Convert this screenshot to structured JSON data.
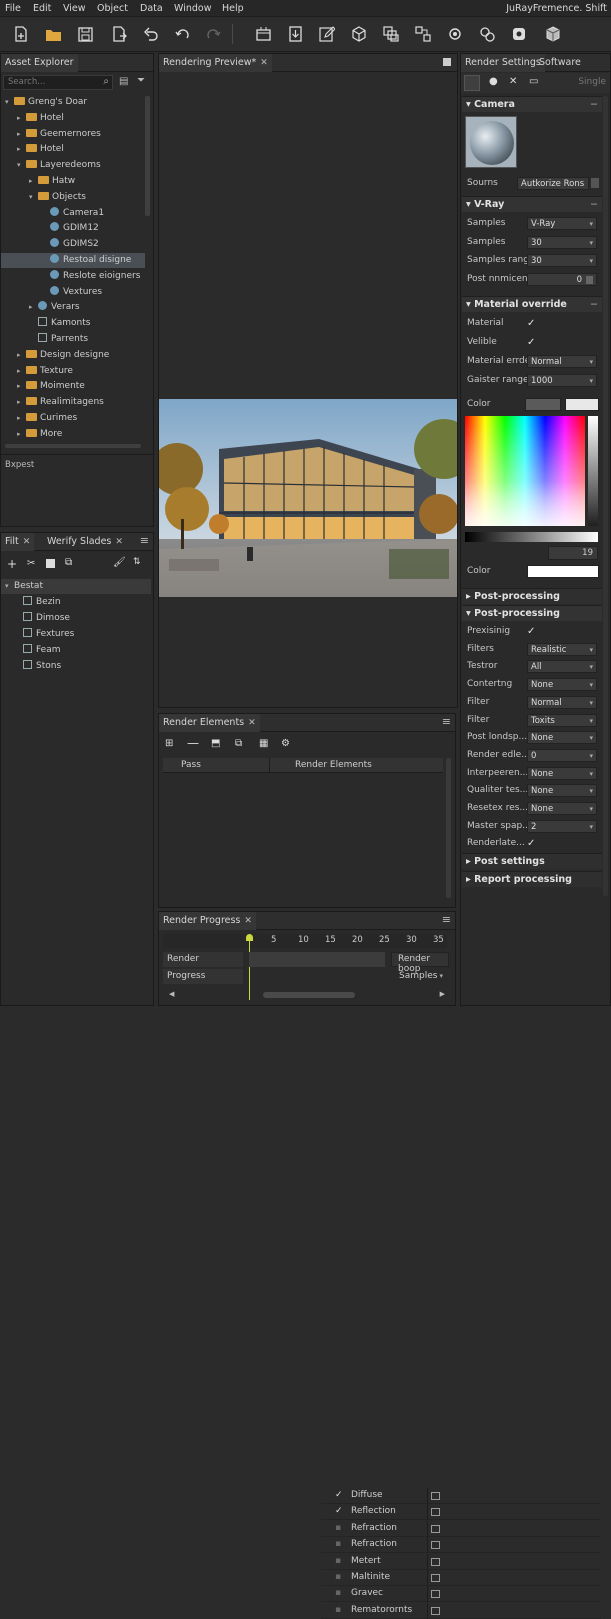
{
  "menu": {
    "items": [
      "File",
      "Edit",
      "View",
      "Object",
      "Data",
      "Window",
      "Help"
    ],
    "title": "JuRayFremence. Shift"
  },
  "toolbar": {
    "icons": [
      "new-file-icon",
      "open-folder-icon",
      "save-icon",
      "export-icon",
      "undo-icon",
      "undo-alt-icon",
      "redo-icon",
      "render-region-icon",
      "import-icon",
      "edit-icon",
      "cube-icon",
      "layers-icon",
      "transform-icon",
      "settings-icon",
      "gears-icon",
      "package-icon"
    ]
  },
  "asset_explorer": {
    "tab": "Asset Explorer",
    "search_placeholder": "Search...",
    "tree": [
      {
        "label": "Greng's Doar",
        "level": 0,
        "type": "folder",
        "open": true
      },
      {
        "label": "Hotel",
        "level": 1,
        "type": "folder"
      },
      {
        "label": "Geemernores",
        "level": 1,
        "type": "folder"
      },
      {
        "label": "Hotel",
        "level": 1,
        "type": "folder"
      },
      {
        "label": "Layeredeoms",
        "level": 1,
        "type": "folder",
        "open": true
      },
      {
        "label": "Hatw",
        "level": 2,
        "type": "folder"
      },
      {
        "label": "Objects",
        "level": 2,
        "type": "folder",
        "open": true
      },
      {
        "label": "Camera1",
        "level": 3,
        "type": "geo"
      },
      {
        "label": "GDIM12",
        "level": 3,
        "type": "geo"
      },
      {
        "label": "GDIMS2",
        "level": 3,
        "type": "geo"
      },
      {
        "label": "Restoal disigne",
        "level": 3,
        "type": "geo",
        "selected": true
      },
      {
        "label": "Reslote eioigners",
        "level": 3,
        "type": "geo"
      },
      {
        "label": "Vextures",
        "level": 3,
        "type": "geo"
      },
      {
        "label": "Verars",
        "level": 2,
        "type": "geo"
      },
      {
        "label": "Kamonts",
        "level": 2,
        "type": "square"
      },
      {
        "label": "Parrents",
        "level": 2,
        "type": "square"
      },
      {
        "label": "Design designe",
        "level": 1,
        "type": "folder"
      },
      {
        "label": "Texture",
        "level": 1,
        "type": "folder"
      },
      {
        "label": "Moimente",
        "level": 1,
        "type": "folder"
      },
      {
        "label": "Realimitagens",
        "level": 1,
        "type": "folder"
      },
      {
        "label": "Curimes",
        "level": 1,
        "type": "folder"
      },
      {
        "label": "More",
        "level": 1,
        "type": "folder"
      }
    ],
    "footer": "Bxpest"
  },
  "filter_panel": {
    "tabs": [
      "Filt",
      "Werify Slades"
    ],
    "items": [
      {
        "label": "Bestat",
        "header": true
      },
      {
        "label": "Bezin"
      },
      {
        "label": "Dimose"
      },
      {
        "label": "Fextures"
      },
      {
        "label": "Feam"
      },
      {
        "label": "Stons"
      }
    ]
  },
  "preview": {
    "tab": "Rendering Preview*"
  },
  "render_elements": {
    "tab": "Render Elements",
    "col_pass": "Pass",
    "col_elements": "Render Elements",
    "rows": [
      {
        "name": "Diffuse",
        "checked": true
      },
      {
        "name": "Reflection",
        "checked": true
      },
      {
        "name": "Refraction",
        "checked": false
      },
      {
        "name": "Refraction",
        "checked": false
      },
      {
        "name": "Metert",
        "checked": false
      },
      {
        "name": "Maltinite",
        "checked": false
      },
      {
        "name": "Gravec",
        "checked": false
      },
      {
        "name": "Rematorornts",
        "checked": false
      }
    ]
  },
  "render_progress": {
    "tab": "Render Progress",
    "ticks": [
      "5",
      "10",
      "15",
      "20",
      "25",
      "30",
      "35"
    ],
    "render_label": "Render",
    "progress_label": "Progress",
    "render_button": "Render boop",
    "samples_label": "Samples"
  },
  "render_settings": {
    "tabs": [
      "Render Settings",
      "Software"
    ],
    "sub_label": "Single",
    "camera": {
      "title": "Camera",
      "sources_label": "Sourns",
      "sources_value": "Autkorize Rons"
    },
    "vray": {
      "title": "V-Ray",
      "rows": [
        {
          "label": "Samples",
          "value": "V-Ray",
          "dd": true
        },
        {
          "label": "Samples",
          "value": "30",
          "dd": true
        },
        {
          "label": "Samples rang",
          "value": "30",
          "dd": true
        },
        {
          "label": "Post nnmicen",
          "value": "0",
          "dd": false
        }
      ]
    },
    "material_override": {
      "title": "Material override",
      "rows": [
        {
          "label": "Material",
          "check": true
        },
        {
          "label": "Velible",
          "check": true
        },
        {
          "label": "Material errde",
          "value": "Normal",
          "dd": true
        },
        {
          "label": "Gaister range",
          "value": "1000",
          "dd": true
        }
      ],
      "color_label": "Color",
      "color_label2": "Color",
      "color_value": "19"
    },
    "post_processing_collapsed": "Post-processing",
    "post_processing": {
      "title": "Post-processing",
      "rows": [
        {
          "label": "Prexisinig",
          "check": true
        },
        {
          "label": "Filters",
          "value": "Realistic",
          "dd": true
        },
        {
          "label": "Testror",
          "value": "All",
          "dd": true
        },
        {
          "label": "Contertng",
          "value": "None",
          "dd": true
        },
        {
          "label": "Filter",
          "value": "Normal",
          "dd": true
        },
        {
          "label": "Filter",
          "value": "Toxits",
          "dd": true
        },
        {
          "label": "Post londsp...",
          "value": "None",
          "dd": true
        },
        {
          "label": "Render edle...",
          "value": "0",
          "dd": true
        },
        {
          "label": "Interpeeren...",
          "value": "None",
          "dd": true
        },
        {
          "label": "Qualiter tes...",
          "value": "None",
          "dd": true
        },
        {
          "label": "Resetex res...",
          "value": "None",
          "dd": true
        },
        {
          "label": "Master spap...",
          "value": "2",
          "dd": true
        },
        {
          "label": "Renderlate...",
          "check": true
        }
      ]
    },
    "post_settings": "Post settings",
    "report_processing": "Report processing"
  }
}
